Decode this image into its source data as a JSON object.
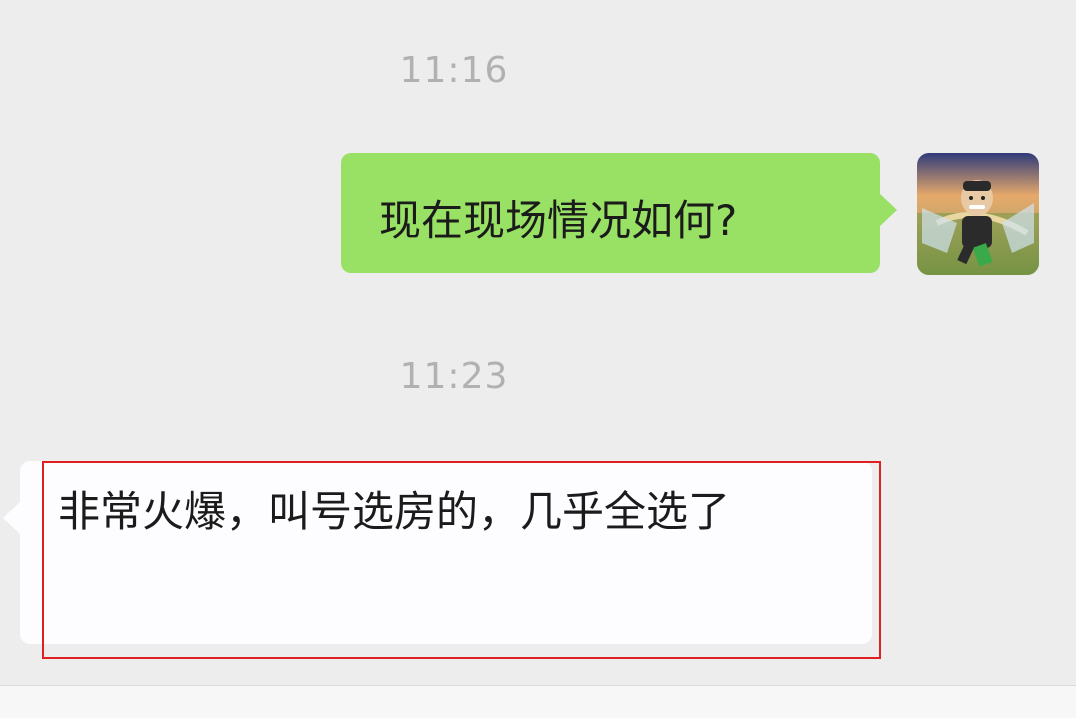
{
  "chat": {
    "messages": [
      {
        "type": "timestamp",
        "text": "11:16"
      },
      {
        "type": "outgoing",
        "text": "现在现场情况如何?"
      },
      {
        "type": "timestamp",
        "text": "11:23"
      },
      {
        "type": "incoming",
        "text": "非常火爆，叫号选房的，几乎全选了"
      }
    ]
  },
  "colors": {
    "background": "#ededed",
    "outgoing_bubble": "#98e165",
    "incoming_bubble": "#fdfcfe",
    "timestamp_text": "#b1b1b1",
    "highlight_border": "#e02020"
  },
  "icons": {
    "avatar": "user-avatar-icon"
  }
}
